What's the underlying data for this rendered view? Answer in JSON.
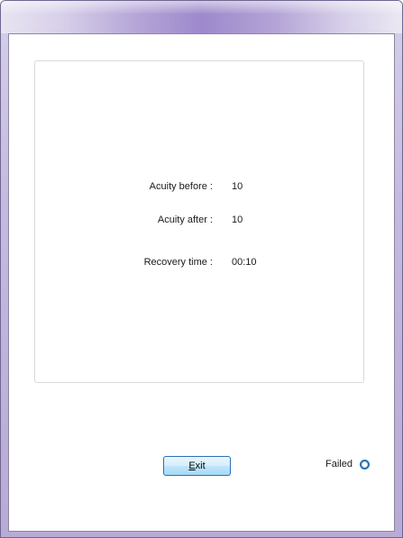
{
  "results": {
    "acuity_before_label": "Acuity before :",
    "acuity_before_value": "10",
    "acuity_after_label": "Acuity after :",
    "acuity_after_value": "10",
    "recovery_time_label": "Recovery time :",
    "recovery_time_value": "00:10"
  },
  "footer": {
    "exit_label_accel": "E",
    "exit_label_rest": "xit",
    "status_text": "Failed",
    "status_icon": "radio-indicator-icon",
    "status_color": "#2d6fb3"
  }
}
